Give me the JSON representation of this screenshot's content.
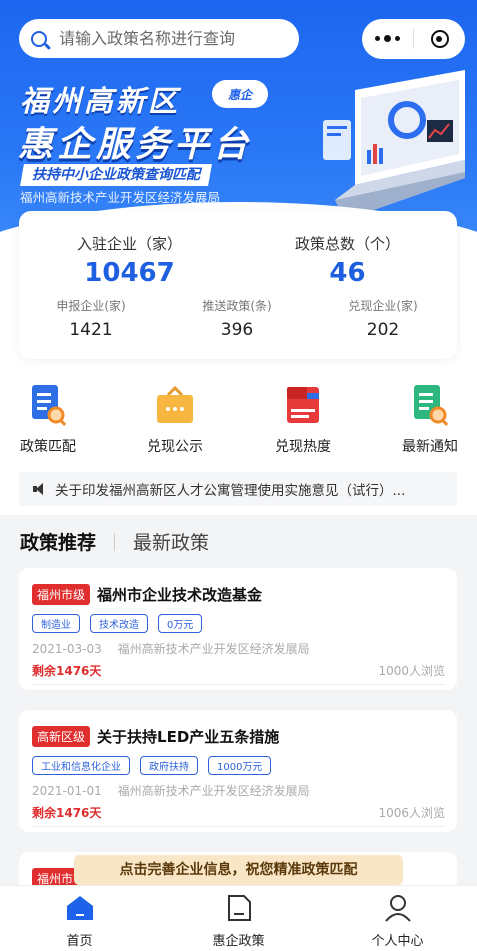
{
  "search": {
    "placeholder": "请输入政策名称进行查询"
  },
  "banner": {
    "title_line1": "福州高新区",
    "title_line2": "惠企服务平台",
    "logo_text": "惠企",
    "tagline": "扶持中小企业政策查询匹配",
    "subtitle": "福州高新技术产业开发区经济发展局"
  },
  "stats": {
    "big": [
      {
        "label": "入驻企业（家）",
        "value": "10467"
      },
      {
        "label": "政策总数（个）",
        "value": "46"
      }
    ],
    "small": [
      {
        "label": "申报企业(家)",
        "value": "1421"
      },
      {
        "label": "推送政策(条)",
        "value": "396"
      },
      {
        "label": "兑现企业(家)",
        "value": "202"
      }
    ]
  },
  "quick": [
    {
      "label": "政策匹配",
      "icon": "doc-search-icon"
    },
    {
      "label": "兑现公示",
      "icon": "briefcase-icon"
    },
    {
      "label": "兑现热度",
      "icon": "flag-folder-icon"
    },
    {
      "label": "最新通知",
      "icon": "notice-search-icon"
    }
  ],
  "notice": {
    "text": "关于印发福州高新区人才公寓管理使用实施意见（试行）..."
  },
  "tabs": {
    "active": "政策推荐",
    "other": "最新政策"
  },
  "policies": [
    {
      "badge": "福州市级",
      "title": "福州市企业技术改造基金",
      "tags": [
        "制造业",
        "技术改造",
        "0万元"
      ],
      "date": "2021-03-03",
      "dept": "福州高新技术产业开发区经济发展局",
      "remain": "剩余1476天",
      "views": "1000人浏览"
    },
    {
      "badge": "高新区级",
      "title": "关于扶持LED产业五条措施",
      "tags": [
        "工业和信息化企业",
        "政府扶持",
        "1000万元"
      ],
      "date": "2021-01-01",
      "dept": "福州高新技术产业开发区经济发展局",
      "remain": "剩余1476天",
      "views": "1006人浏览"
    },
    {
      "badge": "福州市"
    }
  ],
  "prompt": "点击完善企业信息，祝您精准政策匹配",
  "nav": [
    {
      "label": "首页",
      "icon": "home-icon"
    },
    {
      "label": "惠企政策",
      "icon": "document-icon"
    },
    {
      "label": "个人中心",
      "icon": "user-icon"
    }
  ],
  "colors": {
    "primary": "#1d66f0",
    "accent_red": "#e02d2d",
    "prompt_bg": "#f9e6c7"
  }
}
